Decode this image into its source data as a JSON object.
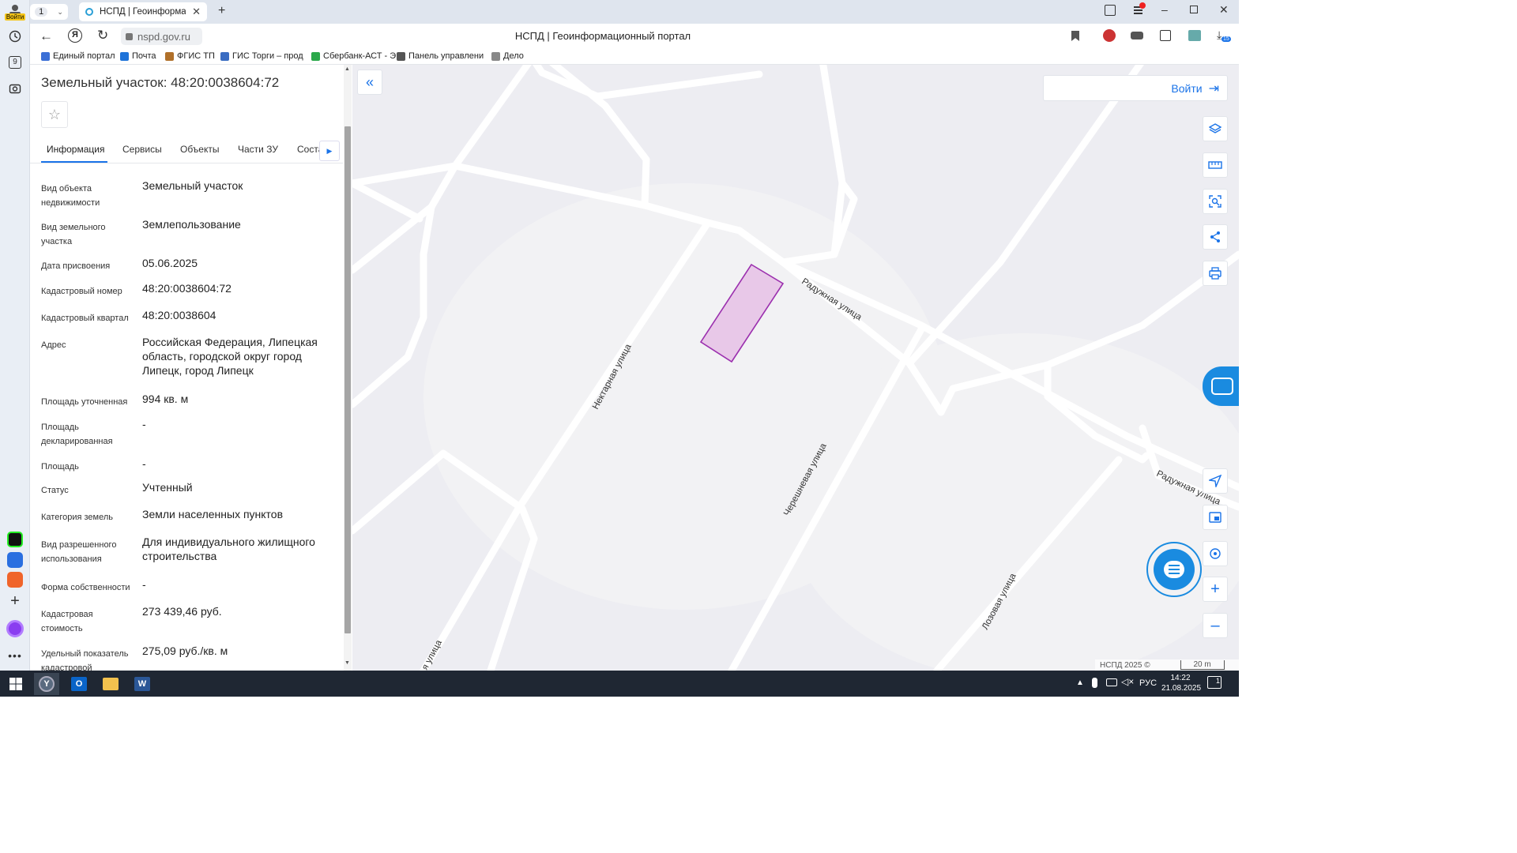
{
  "browser": {
    "tab_count": "1",
    "tab_title": "НСПД | Геоинформационный портал",
    "url": "nspd.gov.ru",
    "page_title": "НСПД | Геоинформационный портал",
    "profile_label": "Войти",
    "downloads_badge": "15",
    "leftbar_badge": "9",
    "bookmarks": [
      {
        "label": "Единый портал",
        "color": "#3b6fd6"
      },
      {
        "label": "Почта",
        "color": "#1e73d9"
      },
      {
        "label": "ФГИС ТП",
        "color": "#b0702a"
      },
      {
        "label": "ГИС Торги – прод",
        "color": "#3a6cc2"
      },
      {
        "label": "Сбербанк-АСТ - Э",
        "color": "#2aa84a"
      },
      {
        "label": "Панель управлени",
        "color": "#555555"
      },
      {
        "label": "Дело",
        "color": "#888888"
      }
    ]
  },
  "panel": {
    "title": "Земельный участок: 48:20:0038604:72",
    "tabs": [
      "Информация",
      "Сервисы",
      "Объекты",
      "Части ЗУ",
      "Соста"
    ],
    "active_tab": 0,
    "fields": [
      {
        "label": "Вид объекта недвижимости",
        "value": "Земельный участок"
      },
      {
        "label": "Вид земельного участка",
        "value": "Землепользование"
      },
      {
        "label": "Дата присвоения",
        "value": "05.06.2025"
      },
      {
        "label": "Кадастровый номер",
        "value": "48:20:0038604:72"
      },
      {
        "label": "Кадастровый квартал",
        "value": "48:20:0038604"
      },
      {
        "label": "Адрес",
        "value": "Российская Федерация, Липецкая область, городской округ город Липецк, город Липецк"
      },
      {
        "label": "Площадь уточненная",
        "value": "994 кв. м"
      },
      {
        "label": "Площадь декларированная",
        "value": "-"
      },
      {
        "label": "Площадь",
        "value": "-"
      },
      {
        "label": "Статус",
        "value": "Учтенный"
      },
      {
        "label": "Категория земель",
        "value": "Земли населенных пунктов"
      },
      {
        "label": "Вид разрешенного использования",
        "value": "Для индивидуального жилищного строительства"
      },
      {
        "label": "Форма собственности",
        "value": "-"
      },
      {
        "label": "Кадастровая стоимость",
        "value": "273 439,46 руб."
      },
      {
        "label": "Удельный показатель кадастровой",
        "value": "275,09 руб./кв. м"
      }
    ]
  },
  "map": {
    "login_label": "Войти",
    "streets": {
      "raduzhnaya": "Радужная улица",
      "nektarnaya": "Нектарная улица",
      "chereshnevaya": "Черешневая улица",
      "lozovaya": "Лозовая улица",
      "bottom_street": "я улица"
    },
    "attribution": "НСПД 2025 ©",
    "scale": "20 m",
    "parcel_fill": "#e8c8e8",
    "parcel_stroke": "#9b2fae",
    "accent": "#1a73e8"
  },
  "taskbar": {
    "lang": "РУС",
    "time": "14:22",
    "date": "21.08.2025",
    "notifications": "1"
  }
}
